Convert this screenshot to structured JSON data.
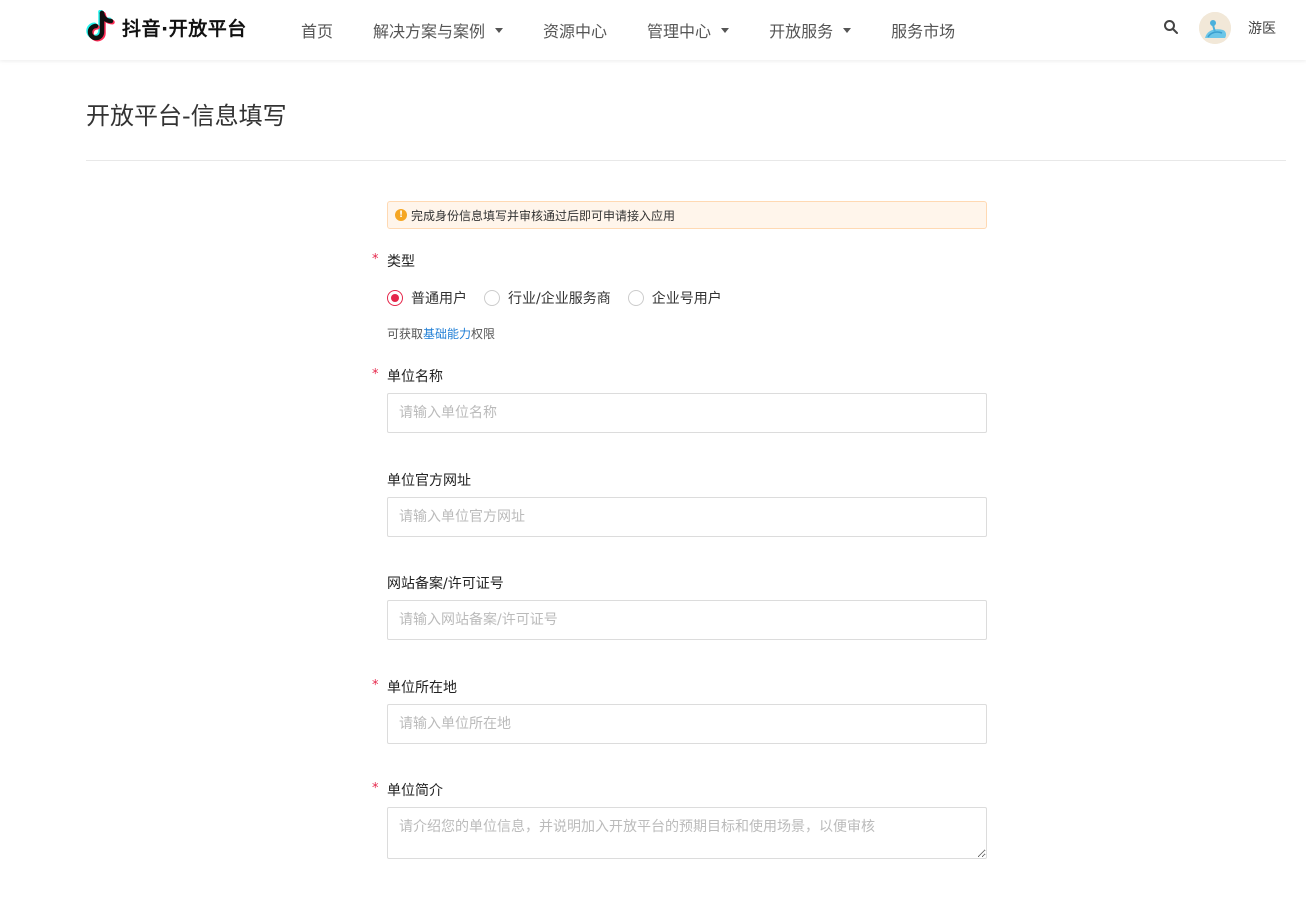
{
  "header": {
    "logo_text": "抖音·开放平台",
    "nav": [
      {
        "label": "首页",
        "has_dropdown": false
      },
      {
        "label": "解决方案与案例",
        "has_dropdown": true
      },
      {
        "label": "资源中心",
        "has_dropdown": false
      },
      {
        "label": "管理中心",
        "has_dropdown": true
      },
      {
        "label": "开放服务",
        "has_dropdown": true
      },
      {
        "label": "服务市场",
        "has_dropdown": false
      }
    ],
    "user_name": "游医"
  },
  "page": {
    "title": "开放平台-信息填写"
  },
  "form": {
    "alert_text": "完成身份信息填写并审核通过后即可申请接入应用",
    "type_label": "类型",
    "type_options": [
      {
        "label": "普通用户",
        "checked": true
      },
      {
        "label": "行业/企业服务商",
        "checked": false
      },
      {
        "label": "企业号用户",
        "checked": false
      }
    ],
    "hint_prefix": "可获取",
    "hint_link": "基础能力",
    "hint_suffix": "权限",
    "org_name_label": "单位名称",
    "org_name_placeholder": "请输入单位名称",
    "website_label": "单位官方网址",
    "website_placeholder": "请输入单位官方网址",
    "icp_label": "网站备案/许可证号",
    "icp_placeholder": "请输入网站备案/许可证号",
    "location_label": "单位所在地",
    "location_placeholder": "请输入单位所在地",
    "intro_label": "单位简介",
    "intro_placeholder": "请介绍您的单位信息，并说明加入开放平台的预期目标和使用场景，以便审核"
  },
  "colors": {
    "accent": "#e5264a",
    "link": "#1e7ed6",
    "alert_bg": "#fff5eb",
    "alert_icon": "#f5a623"
  },
  "icons": {
    "logo": "douyin-note-icon",
    "search": "search-icon",
    "alert": "exclamation-icon"
  }
}
